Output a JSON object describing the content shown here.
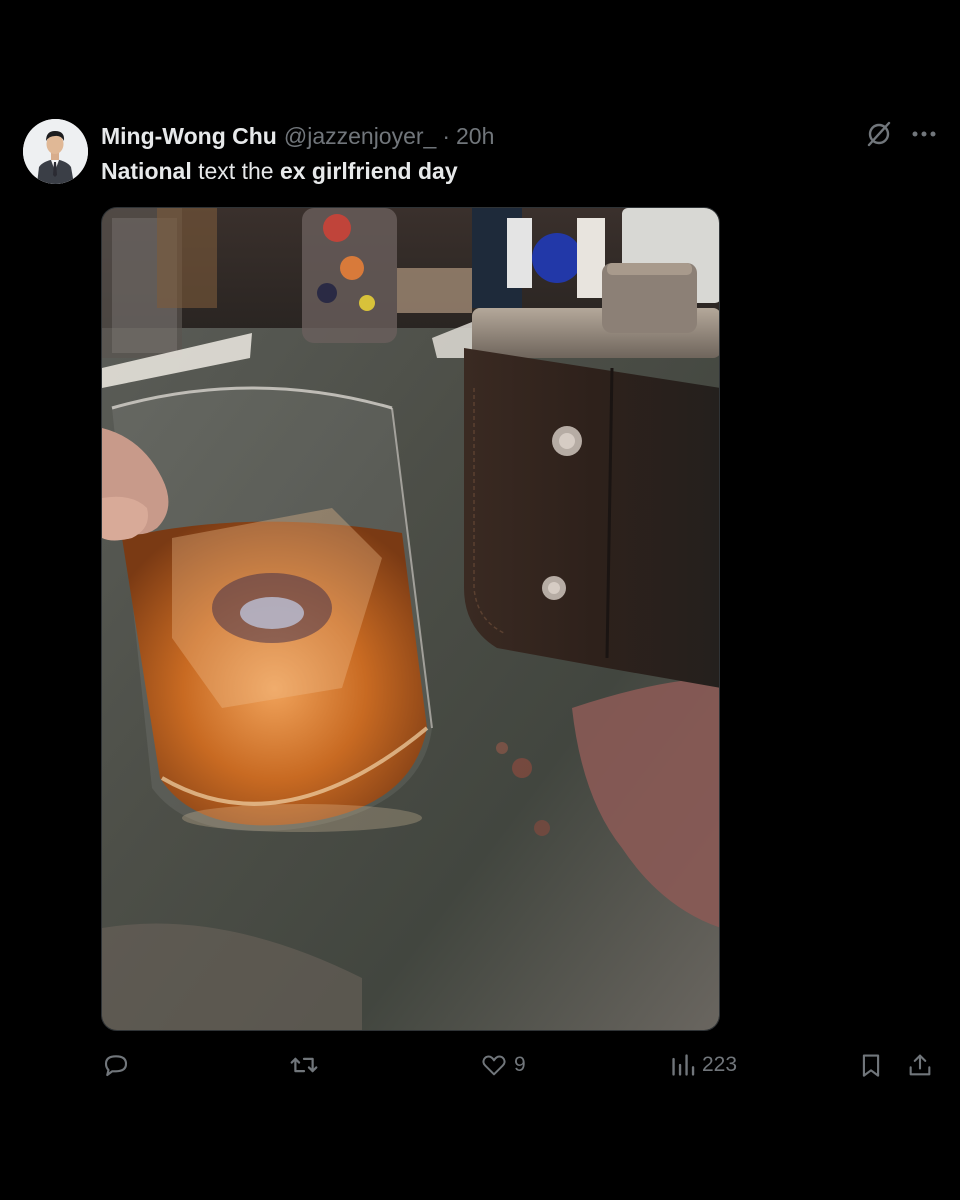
{
  "post": {
    "author": {
      "display_name": "Ming-Wong Chu",
      "handle": "@jazzenjoyer_",
      "separator": "·",
      "timestamp": "20h"
    },
    "text": {
      "part1": "National",
      "part2": " text the ",
      "part3": "ex girlfriend day"
    },
    "media": {
      "alt": "Whiskey glass with ice next to a leather-wrapped flask on a marble bar top"
    },
    "stats": {
      "replies": "",
      "reposts": "",
      "likes": "9",
      "views": "223"
    }
  },
  "icons": {
    "grok": "grok-icon",
    "more": "more-icon",
    "reply": "reply-icon",
    "repost": "repost-icon",
    "like": "heart-icon",
    "views": "views-icon",
    "bookmark": "bookmark-icon",
    "share": "share-icon"
  },
  "colors": {
    "background": "#000000",
    "text_primary": "#e7e9ea",
    "text_secondary": "#71767b"
  }
}
